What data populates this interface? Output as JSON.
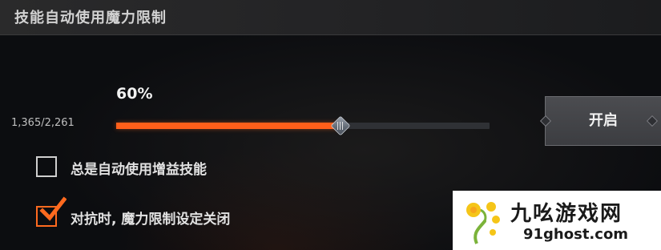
{
  "header": {
    "title": "技能自动使用魔力限制"
  },
  "mana_limit": {
    "percent_label": "60%",
    "percent": 60,
    "value_text": "1,365/2,261"
  },
  "toggle_button": {
    "label": "开启"
  },
  "options": [
    {
      "label": "总是自动使用增益技能",
      "checked": false
    },
    {
      "label": "对抗时, 魔力限制设定关闭",
      "checked": true
    }
  ],
  "colors": {
    "accent": "#ff5f1a",
    "track": "#2f3135",
    "background": "#0c0d10"
  },
  "watermark": {
    "name": "九吆游戏网",
    "url": "91ghost.com",
    "icon": "dandelion-logo-icon"
  }
}
